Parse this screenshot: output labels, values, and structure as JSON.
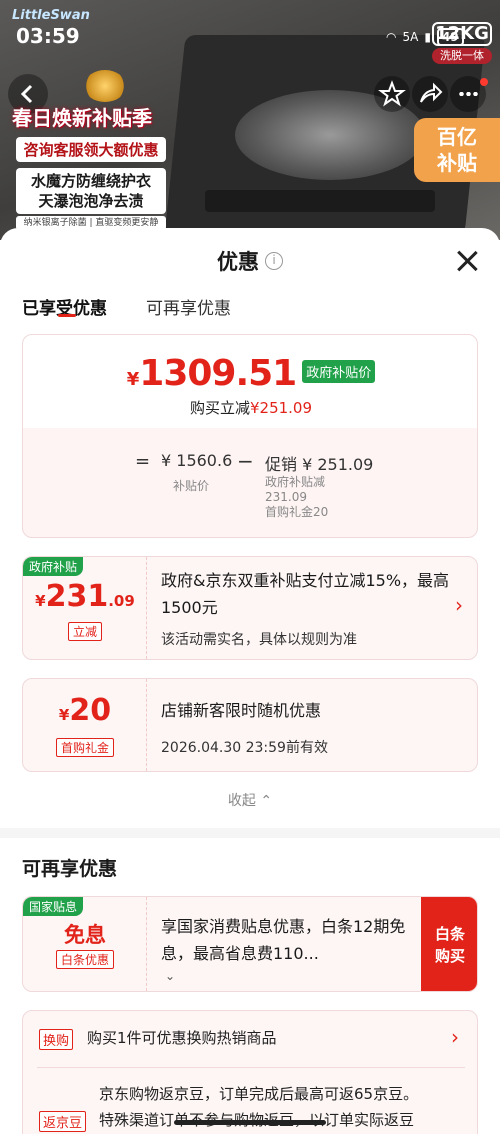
{
  "status_bar": {
    "brand": "LittleSwan",
    "time": "03:59",
    "signal": "5A",
    "battery": "49"
  },
  "product": {
    "capacity": "12KG",
    "capacity_sub": "洗脱一体",
    "promo_title": "春日焕新补贴季",
    "promo_pill": "咨询客服领大额优惠",
    "promo_line1": "水魔方防缠绕护衣",
    "promo_line2": "天瀑泡泡净去渍",
    "promo_foot": "纳米银离子除菌 | 直驱变频更安静",
    "subsidy_badge_1": "百亿",
    "subsidy_badge_2": "补贴"
  },
  "sheet": {
    "title": "优惠",
    "info_icon": "i",
    "tabs": [
      {
        "label": "已享受优惠",
        "active": true
      },
      {
        "label": "可再享优惠",
        "active": false
      }
    ]
  },
  "summary": {
    "currency": "¥",
    "final_price": "1309.51",
    "price_tag": "政府补贴价",
    "discount_label": "购买立减",
    "discount_value": "¥251.09",
    "eq": "=",
    "original": "¥ 1560.6",
    "original_label": "补贴价",
    "minus": "−",
    "promo": "促销 ¥ 251.09",
    "promo_detail_1": "政府补贴减",
    "promo_detail_2": "231.09",
    "promo_detail_3": "首购礼金20"
  },
  "offers": [
    {
      "corner": "政府补贴",
      "yen": "¥",
      "amount_int": "231",
      "amount_dec": ".09",
      "chip": "立减",
      "text": "政府&京东双重补贴支付立减15%，最高1500元",
      "sub": "该活动需实名，具体以规则为准",
      "chevron": "›"
    },
    {
      "yen": "¥",
      "amount_int": "20",
      "chip": "首购礼金",
      "text": "店铺新客限时随机优惠",
      "sub": "2026.04.30 23:59前有效"
    }
  ],
  "collapse_label": "收起 ⌃",
  "more_section": {
    "title": "可再享优惠",
    "free": {
      "corner": "国家贴息",
      "amount": "免息",
      "chip": "白条优惠",
      "text": "享国家消费贴息优惠，白条12期免息，最高省息费110...",
      "expand": "⌄",
      "button_line1": "白条",
      "button_line2": "购买"
    },
    "trade_chip": "换购",
    "trade_text": "购买1件可优惠换购热销商品",
    "trade_chevron": "›",
    "bean_chip": "返京豆",
    "bean_text_1": "京东购物返京豆，订单完成后最高可返65京豆。",
    "bean_text_2": "特殊渠道订单不参与购物返豆，以订单实际返豆"
  }
}
